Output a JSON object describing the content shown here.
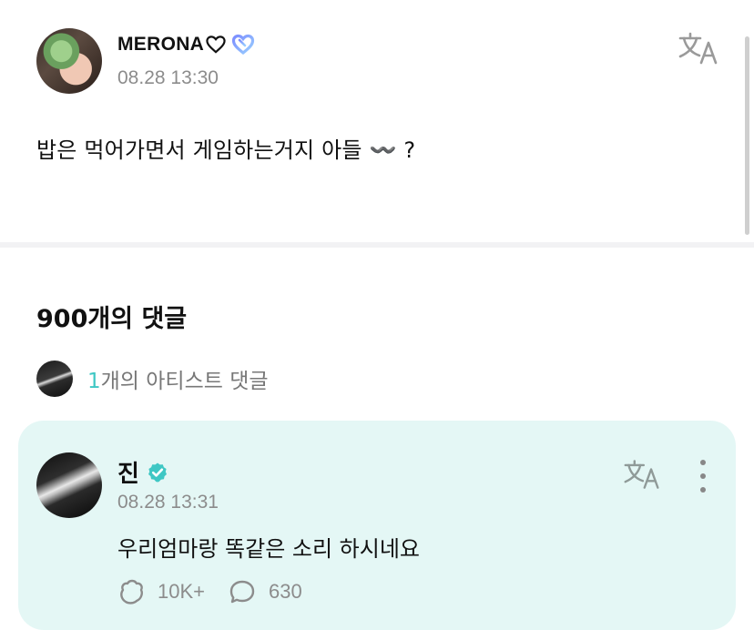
{
  "post": {
    "author": "MERONA",
    "timestamp": "08.28 13:30",
    "body": "밥은 먹어가면서 게임하는거지 아들 〰️ ?",
    "translate_icon": "translate-icon",
    "badge_colors": [
      "#7b8cff",
      "#9ad0ff"
    ]
  },
  "comments": {
    "count_label": "900개의 댓글",
    "artist_count": "1",
    "artist_label": "개의 아티스트 댓글",
    "accent": "#3fc7c4",
    "card_bg": "#e4f7f5",
    "artist_comment": {
      "name": "진",
      "timestamp": "08.28 13:31",
      "body": "우리엄마랑 똑같은 소리 하시네요",
      "likes": "10K+",
      "replies": "630"
    }
  }
}
